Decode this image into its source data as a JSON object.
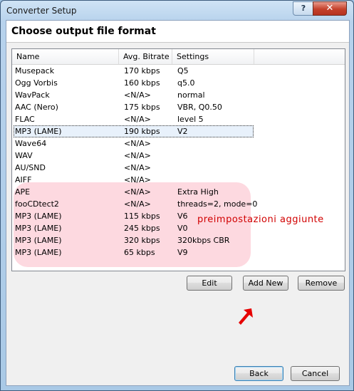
{
  "window": {
    "title": "Converter Setup",
    "help_label": "?",
    "close_label": "✕"
  },
  "page": {
    "title": "Choose output file format"
  },
  "list": {
    "columns": [
      "Name",
      "Avg. Bitrate",
      "Settings"
    ],
    "selected_index": 5,
    "highlighted_rows": [
      10,
      11,
      12,
      13,
      14,
      15
    ],
    "highlight_color": "#fdd9e0",
    "rows": [
      {
        "name": "Musepack",
        "bitrate": "170 kbps",
        "settings": "Q5"
      },
      {
        "name": "Ogg Vorbis",
        "bitrate": "160 kbps",
        "settings": "q5.0"
      },
      {
        "name": "WavPack",
        "bitrate": "<N/A>",
        "settings": "normal"
      },
      {
        "name": "AAC (Nero)",
        "bitrate": "175 kbps",
        "settings": "VBR, Q0.50"
      },
      {
        "name": "FLAC",
        "bitrate": "<N/A>",
        "settings": "level 5"
      },
      {
        "name": "MP3 (LAME)",
        "bitrate": "190 kbps",
        "settings": "V2"
      },
      {
        "name": "Wave64",
        "bitrate": "<N/A>",
        "settings": ""
      },
      {
        "name": "WAV",
        "bitrate": "<N/A>",
        "settings": ""
      },
      {
        "name": "AU/SND",
        "bitrate": "<N/A>",
        "settings": ""
      },
      {
        "name": "AIFF",
        "bitrate": "<N/A>",
        "settings": ""
      },
      {
        "name": "APE",
        "bitrate": "<N/A>",
        "settings": "Extra High"
      },
      {
        "name": "fooCDtect2",
        "bitrate": "<N/A>",
        "settings": "threads=2, mode=0"
      },
      {
        "name": "MP3 (LAME)",
        "bitrate": "115 kbps",
        "settings": "V6"
      },
      {
        "name": "MP3 (LAME)",
        "bitrate": "245 kbps",
        "settings": "V0"
      },
      {
        "name": "MP3 (LAME)",
        "bitrate": "320 kbps",
        "settings": "320kbps CBR"
      },
      {
        "name": "MP3 (LAME)",
        "bitrate": "65 kbps",
        "settings": "V9"
      }
    ]
  },
  "annotation": {
    "text": "preimpostazioni aggiunte",
    "color": "#d10000"
  },
  "actions": {
    "edit": "Edit",
    "add_new": "Add New",
    "remove": "Remove"
  },
  "nav": {
    "back": "Back",
    "cancel": "Cancel"
  },
  "icons": {
    "pointer": "red-arrow-icon"
  }
}
